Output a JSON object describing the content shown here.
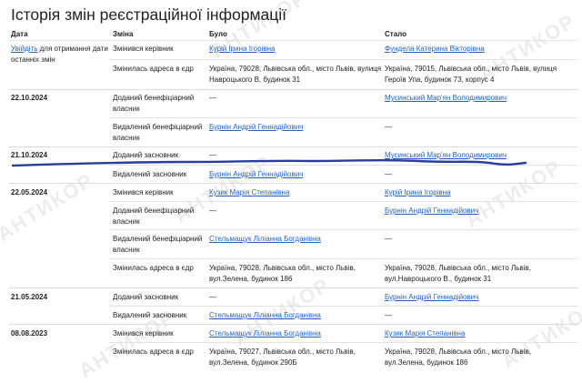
{
  "title": "Історія змін реєстраційної інформації",
  "watermark": "АНТИКОР",
  "headers": {
    "date": "Дата",
    "change": "Зміна",
    "was": "Було",
    "became": "Стало"
  },
  "login_prompt": {
    "link": "Увійдіть",
    "rest1": " для отримання дати",
    "rest2": "останніх змін"
  },
  "rows": [
    {
      "date": "",
      "change": "Змінився керівник",
      "was": "Курій Ірина Ігорівна",
      "became": "Фундела Катерина Вікторівна"
    },
    {
      "date": "",
      "change": "Змінилась адреса в єдр",
      "was": "Україна, 79028, Львівська обл., місто Львів, вулиця",
      "was2": "Навроцького В, будинок 31",
      "became": "Україна, 79015, Львівська обл., місто Львів, вулиця",
      "became2": "Героїв Упа, будинок 73, корпус 4"
    },
    {
      "date": "22.10.2024",
      "change": "Доданий бенефіціарний",
      "change2": "власник",
      "was": "—",
      "became": "Мусинський Мар'ян Володимирович"
    },
    {
      "date": "",
      "change": "Видалений бенефіціарний",
      "change2": "власник",
      "was": "Бурнін Андрій Геннадійович",
      "became": "—"
    },
    {
      "date": "21.10.2024",
      "change": "Доданий засновник",
      "was": "—",
      "became": "Мусинський Мар'ян Володимирович"
    },
    {
      "date": "",
      "change": "Видалений засновник",
      "was": "Бурнін Андрій Геннадійович",
      "became": "—"
    },
    {
      "date": "22.05.2024",
      "change": "Змінився керівник",
      "was": "Кузик Марія Степанівна",
      "became": "Курій Ірина Ігорівна"
    },
    {
      "date": "",
      "change": "Доданий бенефіціарний",
      "change2": "власник",
      "was": "—",
      "became": "Бурнін Андрій Геннадійович"
    },
    {
      "date": "",
      "change": "Видалений бенефіціарний",
      "change2": "власник",
      "was": "Стельмащук Ліліанна Богданівна",
      "became": "—"
    },
    {
      "date": "",
      "change": "Змінилась адреса в єдр",
      "was": "Україна, 79028, Львівська обл., місто Львів,",
      "was2": "вул.Зелена, будинок 186",
      "became": "Україна, 79028, Львівська обл., місто Львів,",
      "became2": "вул.Навроцького В., будинок 31"
    },
    {
      "date": "21.05.2024",
      "change": "Доданий засновник",
      "was": "—",
      "became": "Бурнін Андрій Геннадійович"
    },
    {
      "date": "",
      "change": "Видалений засновник",
      "was": "Стельмащук Ліліанна Богданівна",
      "became": "—"
    },
    {
      "date": "08.08.2023",
      "change": "Змінився керівник",
      "was": "Стельмащук Ліліанна Богданівна",
      "became": "Кузик Марія Степанівна"
    },
    {
      "date": "",
      "change": "Змінилась адреса в єдр",
      "was": "Україна, 79027, Львівська обл., місто Львів,",
      "was2": "вул.Зелена, будинок 290Б",
      "became": "Україна, 79028, Львівська обл., місто Львів,",
      "became2": "вул.Зелена, будинок 186"
    }
  ]
}
